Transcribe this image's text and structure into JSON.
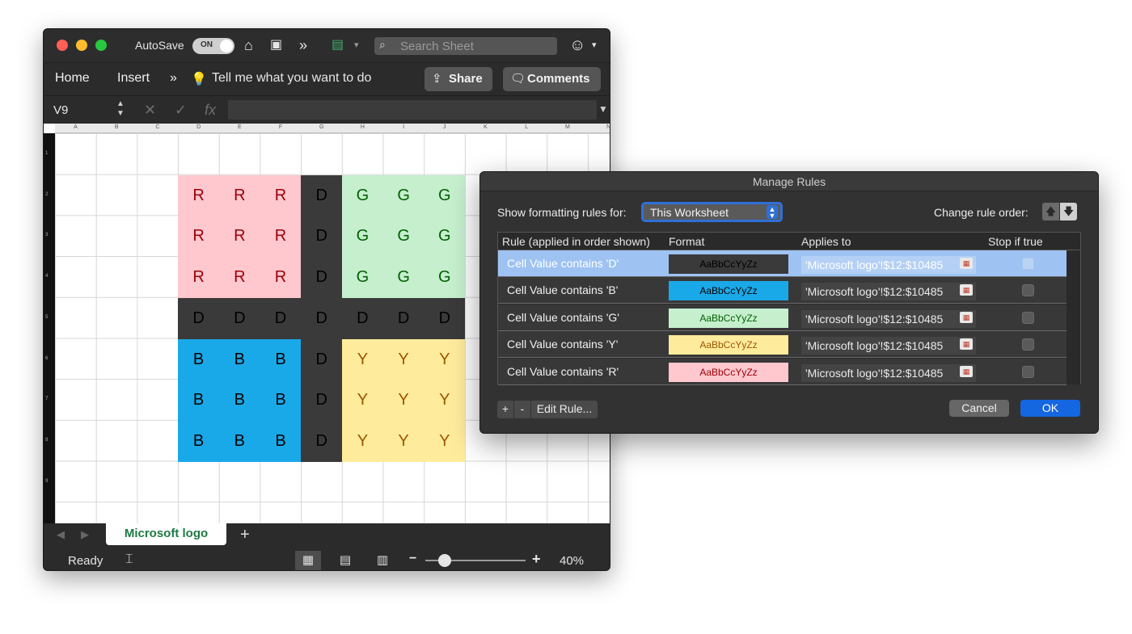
{
  "excel": {
    "autosave_label": "AutoSave",
    "autosave_state": "ON",
    "search_placeholder": "Search Sheet",
    "ribbon": {
      "home": "Home",
      "insert": "Insert",
      "tell_me": "Tell me what you want to do",
      "share": "Share",
      "comments": "Comments"
    },
    "name_box": "V9",
    "columns": [
      "A",
      "B",
      "C",
      "D",
      "E",
      "F",
      "G",
      "H",
      "I",
      "J",
      "K",
      "L",
      "M",
      "N"
    ],
    "rows": [
      "1",
      "2",
      "3",
      "4",
      "5",
      "6",
      "7",
      "8",
      "9"
    ],
    "grid_values": [
      [
        "R",
        "R",
        "R",
        "D",
        "G",
        "G",
        "G"
      ],
      [
        "R",
        "R",
        "R",
        "D",
        "G",
        "G",
        "G"
      ],
      [
        "R",
        "R",
        "R",
        "D",
        "G",
        "G",
        "G"
      ],
      [
        "D",
        "D",
        "D",
        "D",
        "D",
        "D",
        "D"
      ],
      [
        "B",
        "B",
        "B",
        "D",
        "Y",
        "Y",
        "Y"
      ],
      [
        "B",
        "B",
        "B",
        "D",
        "Y",
        "Y",
        "Y"
      ],
      [
        "B",
        "B",
        "B",
        "D",
        "Y",
        "Y",
        "Y"
      ]
    ],
    "cell_colors": {
      "R": {
        "bg": "#ffc7ce",
        "fg": "#9c0006"
      },
      "G": {
        "bg": "#c6efce",
        "fg": "#006100"
      },
      "B": {
        "bg": "#1aa9e8",
        "fg": "#000000"
      },
      "Y": {
        "bg": "#ffeb9c",
        "fg": "#9c5700"
      },
      "D": {
        "bg": "#3a3a3a",
        "fg": "#000000"
      }
    },
    "sheet_tab": "Microsoft logo",
    "status": "Ready",
    "zoom": "40%"
  },
  "dialog": {
    "title": "Manage Rules",
    "show_rules_label": "Show formatting rules for:",
    "scope_value": "This Worksheet",
    "change_order_label": "Change rule order:",
    "headers": {
      "rule": "Rule (applied in order shown)",
      "format": "Format",
      "applies": "Applies to",
      "stop": "Stop if true"
    },
    "rules": [
      {
        "rule": "Cell Value contains 'D'",
        "preview": "AaBbCcYyZz",
        "applies": "'Microsoft logo'!$12:$10485",
        "fmt_bg": "#3a3a3a",
        "fmt_fg": "#000000",
        "selected": true
      },
      {
        "rule": "Cell Value contains 'B'",
        "preview": "AaBbCcYyZz",
        "applies": "'Microsoft logo'!$12:$10485",
        "fmt_bg": "#1aa9e8",
        "fmt_fg": "#000000",
        "selected": false
      },
      {
        "rule": "Cell Value contains 'G'",
        "preview": "AaBbCcYyZz",
        "applies": "'Microsoft logo'!$12:$10485",
        "fmt_bg": "#c6efce",
        "fmt_fg": "#006100",
        "selected": false
      },
      {
        "rule": "Cell Value contains 'Y'",
        "preview": "AaBbCcYyZz",
        "applies": "'Microsoft logo'!$12:$10485",
        "fmt_bg": "#ffeb9c",
        "fmt_fg": "#9c5700",
        "selected": false
      },
      {
        "rule": "Cell Value contains 'R'",
        "preview": "AaBbCcYyZz",
        "applies": "'Microsoft logo'!$12:$10485",
        "fmt_bg": "#ffc7ce",
        "fmt_fg": "#9c0006",
        "selected": false
      }
    ],
    "buttons": {
      "add": "+",
      "remove": "-",
      "edit": "Edit Rule...",
      "cancel": "Cancel",
      "ok": "OK"
    }
  }
}
